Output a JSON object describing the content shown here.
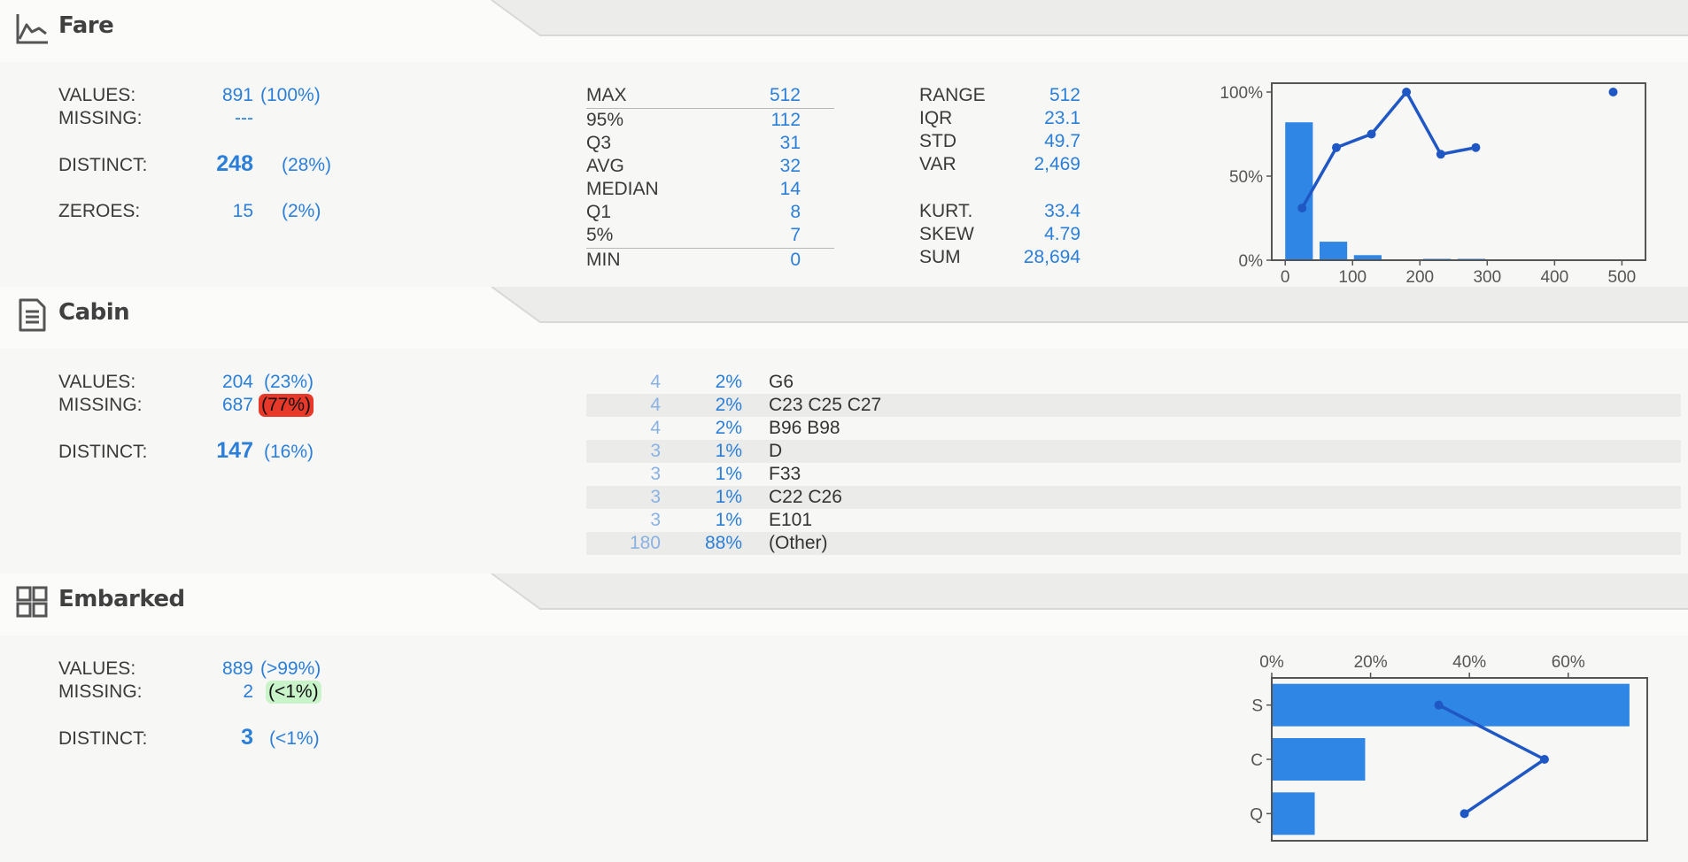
{
  "fare": {
    "title": "Fare",
    "icon": "line-chart-icon",
    "values_label": "VALUES:",
    "values_count": "891",
    "values_pct": "(100%)",
    "missing_label": "MISSING:",
    "missing_value": "---",
    "distinct_label": "DISTINCT:",
    "distinct_count": "248",
    "distinct_pct": "(28%)",
    "zeroes_label": "ZEROES:",
    "zeroes_count": "15",
    "zeroes_pct": "(2%)",
    "quantiles": [
      {
        "label": "MAX",
        "value": "512"
      },
      {
        "label": "95%",
        "value": "112"
      },
      {
        "label": "Q3",
        "value": "31"
      },
      {
        "label": "AVG",
        "value": "32"
      },
      {
        "label": "MEDIAN",
        "value": "14"
      },
      {
        "label": "Q1",
        "value": "8"
      },
      {
        "label": "5%",
        "value": "7"
      },
      {
        "label": "MIN",
        "value": "0"
      }
    ],
    "stats": [
      {
        "label": "RANGE",
        "value": "512"
      },
      {
        "label": "IQR",
        "value": "23.1"
      },
      {
        "label": "STD",
        "value": "49.7"
      },
      {
        "label": "VAR",
        "value": "2,469"
      },
      {
        "label": "KURT.",
        "value": "33.4"
      },
      {
        "label": "SKEW",
        "value": "4.79"
      },
      {
        "label": "SUM",
        "value": "28,694"
      }
    ]
  },
  "cabin": {
    "title": "Cabin",
    "icon": "document-icon",
    "values_label": "VALUES:",
    "values_count": "204",
    "values_pct": "(23%)",
    "missing_label": "MISSING:",
    "missing_count": "687",
    "missing_pct": "(77%)",
    "distinct_label": "DISTINCT:",
    "distinct_count": "147",
    "distinct_pct": "(16%)",
    "frequencies": [
      {
        "count": "4",
        "pct": "2%",
        "name": "G6"
      },
      {
        "count": "4",
        "pct": "2%",
        "name": "C23 C25 C27"
      },
      {
        "count": "4",
        "pct": "2%",
        "name": "B96 B98"
      },
      {
        "count": "3",
        "pct": "1%",
        "name": "D"
      },
      {
        "count": "3",
        "pct": "1%",
        "name": "F33"
      },
      {
        "count": "3",
        "pct": "1%",
        "name": "C22 C26"
      },
      {
        "count": "3",
        "pct": "1%",
        "name": "E101"
      },
      {
        "count": "180",
        "pct": "88%",
        "name": "(Other)"
      }
    ]
  },
  "embarked": {
    "title": "Embarked",
    "icon": "grid-icon",
    "values_label": "VALUES:",
    "values_count": "889",
    "values_pct": "(>99%)",
    "missing_label": "MISSING:",
    "missing_count": "2",
    "missing_pct": "(<1%)",
    "distinct_label": "DISTINCT:",
    "distinct_count": "3",
    "distinct_pct": "(<1%)"
  },
  "colors": {
    "accent": "#2b7fd9",
    "bar": "#2f86e4",
    "line": "#1f57c4",
    "missing_bad": "#e8382a",
    "missing_ok": "#c9f3c9"
  },
  "chart_data": [
    {
      "type": "bar",
      "title": "",
      "x_ticks": [
        "0",
        "100",
        "200",
        "300",
        "400",
        "500"
      ],
      "y_ticks": [
        "0%",
        "50%",
        "100%"
      ],
      "xlim": [
        -20,
        535
      ],
      "ylim": [
        0,
        100
      ],
      "bins": [
        {
          "x0": 0,
          "x1": 41,
          "value": 82
        },
        {
          "x0": 51,
          "x1": 92,
          "value": 11
        },
        {
          "x0": 102,
          "x1": 143,
          "value": 3
        },
        {
          "x0": 153,
          "x1": 194,
          "value": 0.3
        },
        {
          "x0": 205,
          "x1": 246,
          "value": 0.8
        },
        {
          "x0": 256,
          "x1": 297,
          "value": 0.8
        }
      ],
      "line_points": [
        {
          "x": 25,
          "y": 31
        },
        {
          "x": 76,
          "y": 67
        },
        {
          "x": 128,
          "y": 75
        },
        {
          "x": 180,
          "y": 100
        },
        {
          "x": 231,
          "y": 63
        },
        {
          "x": 283,
          "y": 67
        },
        {
          "x": 487,
          "y": 100
        }
      ],
      "line_segments": [
        [
          0,
          1,
          2,
          3,
          4,
          5
        ],
        [
          6
        ]
      ],
      "grid": false,
      "legend": "none"
    },
    {
      "type": "bar",
      "orientation": "horizontal",
      "title": "",
      "categories": [
        "S",
        "C",
        "Q"
      ],
      "values": [
        72.4,
        18.9,
        8.7
      ],
      "x_ticks": [
        "0%",
        "20%",
        "40%",
        "60%"
      ],
      "xlim": [
        0,
        76
      ],
      "line_values": [
        33.8,
        55.2,
        39.0
      ],
      "grid": false,
      "legend": "none"
    }
  ]
}
